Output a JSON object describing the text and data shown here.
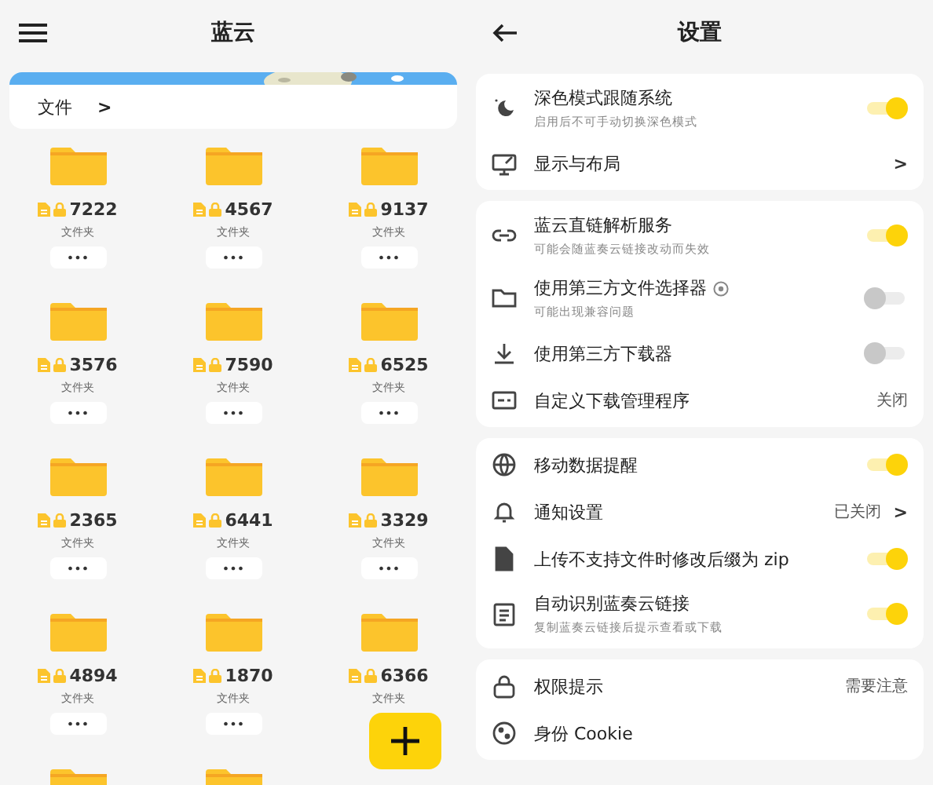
{
  "files_screen": {
    "title": "蓝云",
    "breadcrumb": "文件",
    "breadcrumb_chevron": ">",
    "folders": [
      {
        "name": "7222",
        "type": "文件夹",
        "more": "•••"
      },
      {
        "name": "4567",
        "type": "文件夹",
        "more": "•••"
      },
      {
        "name": "9137",
        "type": "文件夹",
        "more": "•••"
      },
      {
        "name": "3576",
        "type": "文件夹",
        "more": "•••"
      },
      {
        "name": "7590",
        "type": "文件夹",
        "more": "•••"
      },
      {
        "name": "6525",
        "type": "文件夹",
        "more": "•••"
      },
      {
        "name": "2365",
        "type": "文件夹",
        "more": "•••"
      },
      {
        "name": "6441",
        "type": "文件夹",
        "more": "•••"
      },
      {
        "name": "3329",
        "type": "文件夹",
        "more": "•••"
      },
      {
        "name": "4894",
        "type": "文件夹",
        "more": "•••"
      },
      {
        "name": "1870",
        "type": "文件夹",
        "more": "•••"
      },
      {
        "name": "6366",
        "type": "文件夹"
      }
    ]
  },
  "settings_screen": {
    "title": "设置",
    "cards": [
      {
        "rows": [
          {
            "kind": "toggle",
            "label": "深色模式跟随系统",
            "subtitle": "启用后不可手动切换深色模式",
            "on": true
          },
          {
            "kind": "chevron",
            "label": "显示与布局",
            "chevron": ">"
          }
        ]
      },
      {
        "rows": [
          {
            "kind": "toggle",
            "label": "蓝云直链解析服务",
            "subtitle": "可能会随蓝奏云链接改动而失效",
            "on": true
          },
          {
            "kind": "toggle",
            "label": "使用第三方文件选择器",
            "help": true,
            "subtitle": "可能出现兼容问题",
            "on": false
          },
          {
            "kind": "toggle",
            "label": "使用第三方下载器",
            "on": false
          },
          {
            "kind": "value",
            "label": "自定义下载管理程序",
            "value": "关闭"
          }
        ]
      },
      {
        "rows": [
          {
            "kind": "toggle",
            "label": "移动数据提醒",
            "on": true
          },
          {
            "kind": "value",
            "label": "通知设置",
            "value": "已关闭",
            "chevron": ">"
          },
          {
            "kind": "toggle",
            "label": "上传不支持文件时修改后缀为 zip",
            "on": true
          },
          {
            "kind": "toggle",
            "label": "自动识别蓝奏云链接",
            "subtitle": "复制蓝奏云链接后提示查看或下载",
            "on": true
          }
        ]
      },
      {
        "rows": [
          {
            "kind": "value",
            "label": "权限提示",
            "value": "需要注意"
          },
          {
            "kind": "plain",
            "label": "身份 Cookie"
          }
        ]
      }
    ]
  }
}
